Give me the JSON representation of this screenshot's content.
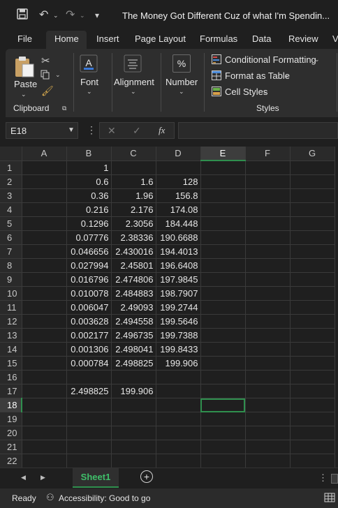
{
  "title": "The Money Got Different Cuz of what I'm Spendin...",
  "ribbon_tabs": [
    "File",
    "Home",
    "Insert",
    "Page Layout",
    "Formulas",
    "Data",
    "Review",
    "V"
  ],
  "clipboard": {
    "paste": "Paste",
    "group": "Clipboard"
  },
  "font": {
    "label": "Font"
  },
  "alignment": {
    "label": "Alignment"
  },
  "number": {
    "label": "Number",
    "icon_text": "%"
  },
  "styles": {
    "conditional": "Conditional Formatting",
    "format_table": "Format as Table",
    "cell_styles": "Cell Styles",
    "group": "Styles"
  },
  "formula_bar": {
    "name_box": "E18",
    "fx": "fx",
    "value": ""
  },
  "columns": [
    "A",
    "B",
    "C",
    "D",
    "E",
    "F",
    "G"
  ],
  "rows": [
    {
      "n": "1",
      "B": "1",
      "C": "",
      "D": ""
    },
    {
      "n": "2",
      "B": "0.6",
      "C": "1.6",
      "D": "128"
    },
    {
      "n": "3",
      "B": "0.36",
      "C": "1.96",
      "D": "156.8"
    },
    {
      "n": "4",
      "B": "0.216",
      "C": "2.176",
      "D": "174.08"
    },
    {
      "n": "5",
      "B": "0.1296",
      "C": "2.3056",
      "D": "184.448"
    },
    {
      "n": "6",
      "B": "0.07776",
      "C": "2.38336",
      "D": "190.6688"
    },
    {
      "n": "7",
      "B": "0.046656",
      "C": "2.430016",
      "D": "194.4013"
    },
    {
      "n": "8",
      "B": "0.027994",
      "C": "2.45801",
      "D": "196.6408"
    },
    {
      "n": "9",
      "B": "0.016796",
      "C": "2.474806",
      "D": "197.9845"
    },
    {
      "n": "10",
      "B": "0.010078",
      "C": "2.484883",
      "D": "198.7907"
    },
    {
      "n": "11",
      "B": "0.006047",
      "C": "2.49093",
      "D": "199.2744"
    },
    {
      "n": "12",
      "B": "0.003628",
      "C": "2.494558",
      "D": "199.5646"
    },
    {
      "n": "13",
      "B": "0.002177",
      "C": "2.496735",
      "D": "199.7388"
    },
    {
      "n": "14",
      "B": "0.001306",
      "C": "2.498041",
      "D": "199.8433"
    },
    {
      "n": "15",
      "B": "0.000784",
      "C": "2.498825",
      "D": "199.906"
    },
    {
      "n": "16",
      "B": "",
      "C": "",
      "D": ""
    },
    {
      "n": "17",
      "B": "2.498825",
      "C": "199.906",
      "D": ""
    },
    {
      "n": "18",
      "B": "",
      "C": "",
      "D": ""
    },
    {
      "n": "19",
      "B": "",
      "C": "",
      "D": ""
    },
    {
      "n": "20",
      "B": "",
      "C": "",
      "D": ""
    },
    {
      "n": "21",
      "B": "",
      "C": "",
      "D": ""
    },
    {
      "n": "22",
      "B": "",
      "C": "",
      "D": ""
    }
  ],
  "active_cell": {
    "column": "E",
    "row": "18"
  },
  "sheet": {
    "name": "Sheet1"
  },
  "status": {
    "ready": "Ready",
    "accessibility": "Accessibility: Good to go"
  },
  "colors": {
    "accent": "#2f8f4e",
    "background": "#1f1f1f",
    "ribbon": "#2e2e2e"
  }
}
